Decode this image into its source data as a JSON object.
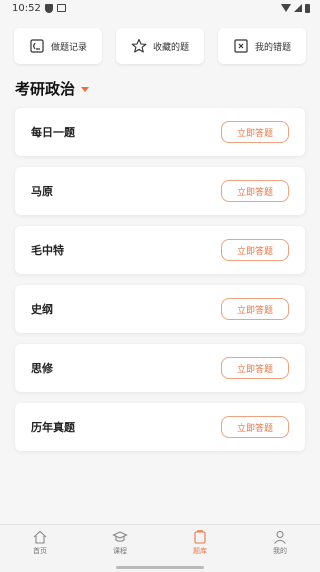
{
  "status_bar": {
    "time": "10:52"
  },
  "quick_actions": [
    {
      "label": "做题记录",
      "icon": "record-icon"
    },
    {
      "label": "收藏的题",
      "icon": "star-icon"
    },
    {
      "label": "我的错题",
      "icon": "wrong-icon"
    }
  ],
  "section": {
    "title": "考研政治"
  },
  "items": [
    {
      "label": "每日一题",
      "button": "立即答题"
    },
    {
      "label": "马原",
      "button": "立即答题"
    },
    {
      "label": "毛中特",
      "button": "立即答题"
    },
    {
      "label": "史纲",
      "button": "立即答题"
    },
    {
      "label": "思修",
      "button": "立即答题"
    },
    {
      "label": "历年真题",
      "button": "立即答题"
    }
  ],
  "tabbar": [
    {
      "label": "首页",
      "icon": "home-icon",
      "active": false
    },
    {
      "label": "课程",
      "icon": "course-icon",
      "active": false
    },
    {
      "label": "题库",
      "icon": "question-bank-icon",
      "active": true
    },
    {
      "label": "我的",
      "icon": "profile-icon",
      "active": false
    }
  ],
  "colors": {
    "accent": "#e8774a",
    "background": "#f6f6f6"
  }
}
